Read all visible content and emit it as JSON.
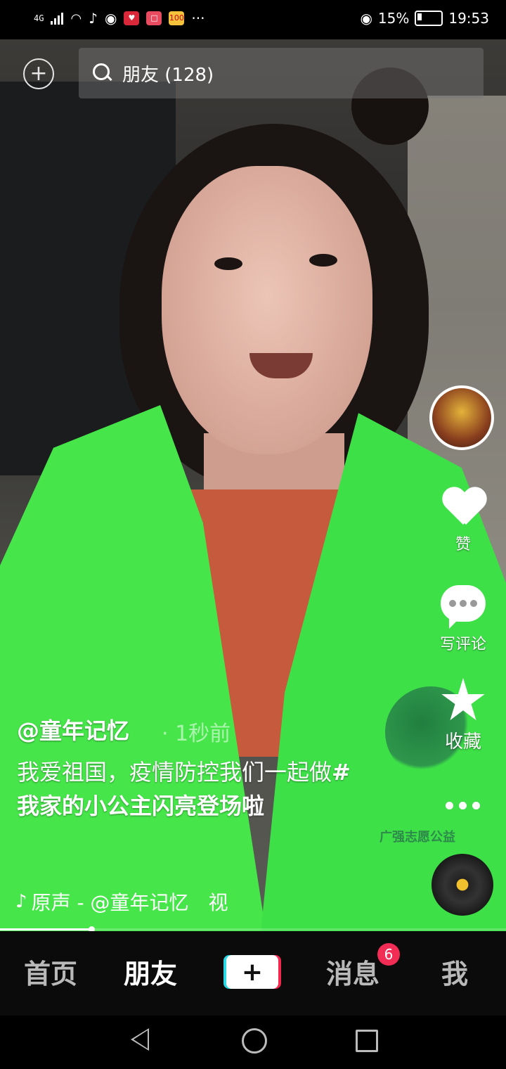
{
  "status_bar": {
    "network": "4G",
    "tiktok_icon": "♪",
    "app_icon_1": "♥",
    "app_icon_2": "□",
    "app_icon_3": "100",
    "more": "···",
    "battery": "15%",
    "time": "19:53"
  },
  "top": {
    "search_text": "朋友 (128)"
  },
  "rail": {
    "like_label": "赞",
    "comment_label": "写评论",
    "favorite_label": "收藏"
  },
  "vest_text": "广强志愿公益",
  "post": {
    "author": "@童年记忆",
    "time": "· 1秒前",
    "caption_plain": "我爱祖国，疫情防控我们一起做",
    "caption_tag": "#我家的小公主闪亮登场啦",
    "music": "原声 - @童年记忆　视",
    "progress": 0.18
  },
  "tabs": {
    "home": "首页",
    "friends": "朋友",
    "create": "+",
    "messages": "消息",
    "messages_badge": "6",
    "me": "我"
  }
}
